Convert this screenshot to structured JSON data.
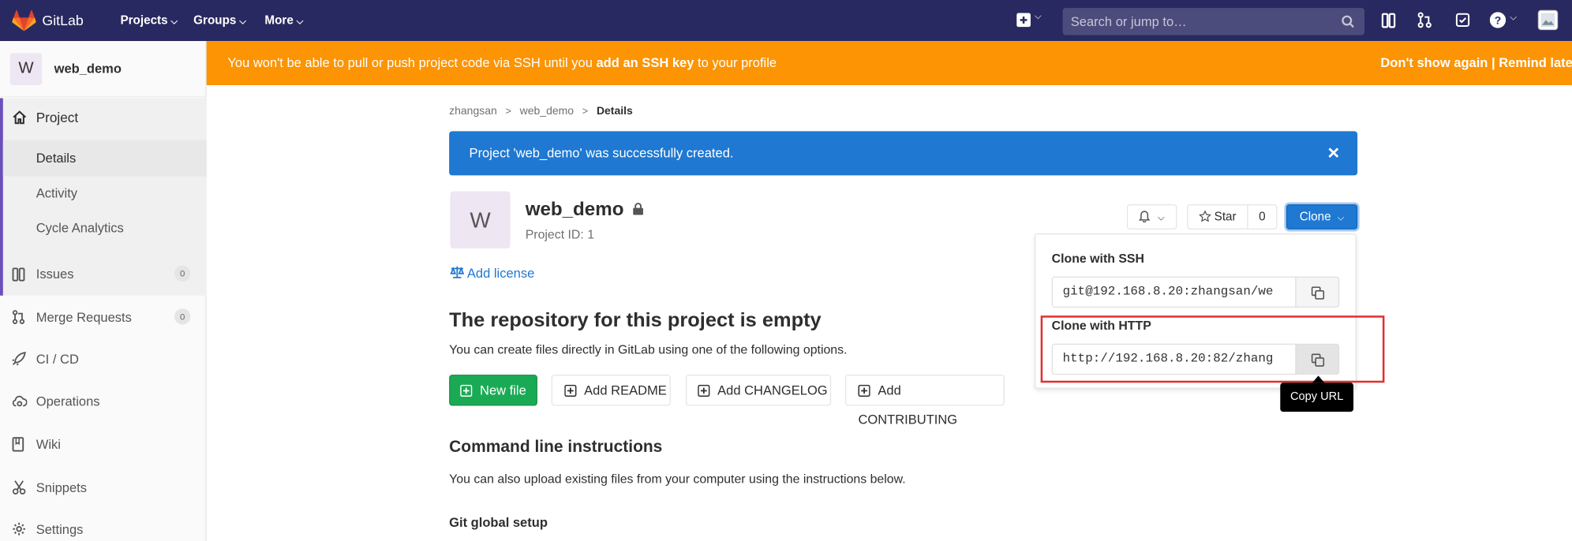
{
  "navbar": {
    "brand": "GitLab",
    "projects": "Projects",
    "groups": "Groups",
    "more": "More",
    "search_placeholder": "Search or jump to…",
    "colors": {
      "bg": "#292961",
      "search_bg": "#4c4c7c"
    }
  },
  "banner": {
    "text_before": "You won't be able to pull or push project code via SSH until you ",
    "link": "add an SSH key",
    "text_after": " to your profile",
    "dont_show": "Don't show again",
    "separator": "|",
    "remind": "Remind late",
    "color": "#fc9403"
  },
  "sidebar": {
    "avatar_letter": "W",
    "project_name": "web_demo",
    "project_label": "Project",
    "subitems": [
      "Details",
      "Activity",
      "Cycle Analytics"
    ],
    "issues": {
      "label": "Issues",
      "count": "0"
    },
    "merge_requests": {
      "label": "Merge Requests",
      "count": "0"
    },
    "ci_cd": "CI / CD",
    "operations": "Operations",
    "wiki": "Wiki",
    "snippets": "Snippets",
    "settings": "Settings"
  },
  "breadcrumb": {
    "items": [
      "zhangsan",
      "web_demo",
      "Details"
    ],
    "separator": ">"
  },
  "flash": {
    "message": "Project 'web_demo' was successfully created.",
    "close": "×",
    "color": "#1f78d1"
  },
  "project": {
    "avatar_letter": "W",
    "name": "web_demo",
    "id_label": "Project ID: 1",
    "add_license": "Add license",
    "star_label": "Star",
    "star_count": "0",
    "clone_label": "Clone"
  },
  "empty_repo": {
    "heading": "The repository for this project is empty",
    "subtext": "You can create files directly in GitLab using one of the following options.",
    "new_file": "New file",
    "add_readme": "Add README",
    "add_changelog": "Add CHANGELOG",
    "add_contributing": "Add CONTRIBUTING"
  },
  "cli": {
    "heading": "Command line instructions",
    "subtext": "You can also upload existing files from your computer using the instructions below.",
    "git_global_setup": "Git global setup"
  },
  "clone_dropdown": {
    "ssh_label": "Clone with SSH",
    "ssh_url": "git@192.168.8.20:zhangsan/we",
    "http_label": "Clone with HTTP",
    "http_url": "http://192.168.8.20:82/zhang",
    "tooltip": "Copy URL",
    "highlight_color": "#e03131"
  }
}
